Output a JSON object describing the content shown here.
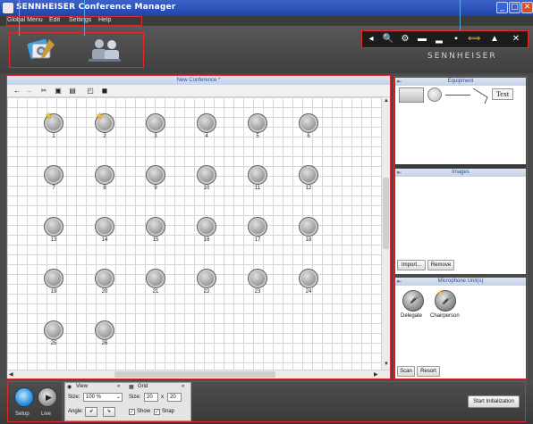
{
  "window": {
    "title": "SENNHEISER Conference Manager",
    "controls": {
      "minimize": "_",
      "maximize": "□",
      "close": "✕"
    }
  },
  "menu": [
    "Global Menu",
    "Edit",
    "Settings",
    "Help"
  ],
  "header": {
    "left_icons": [
      "conference-setup-icon",
      "users-icon"
    ],
    "toolbar_icons": [
      "volume-icon",
      "zoom-icon",
      "settings-icon",
      "card-icon",
      "signal-icon",
      "lock-icon",
      "swap-icon",
      "warning-icon",
      "close-icon"
    ],
    "brand": "SENNHEISER"
  },
  "canvas": {
    "title": "New Conference *",
    "toolbar_icons": [
      "undo-icon",
      "redo-icon",
      "cut-icon",
      "copy-icon",
      "paste-icon",
      "front-icon",
      "back-icon"
    ],
    "microphones": [
      {
        "label": "1",
        "chair": true
      },
      {
        "label": "2",
        "chair": true
      },
      {
        "label": "3"
      },
      {
        "label": "4"
      },
      {
        "label": "5"
      },
      {
        "label": "6"
      },
      {
        "label": "7"
      },
      {
        "label": "8"
      },
      {
        "label": "9"
      },
      {
        "label": "10"
      },
      {
        "label": "11"
      },
      {
        "label": "12"
      },
      {
        "label": "13"
      },
      {
        "label": "14"
      },
      {
        "label": "15"
      },
      {
        "label": "16"
      },
      {
        "label": "17"
      },
      {
        "label": "18"
      },
      {
        "label": "19"
      },
      {
        "label": "20"
      },
      {
        "label": "21"
      },
      {
        "label": "22"
      },
      {
        "label": "23"
      },
      {
        "label": "24"
      },
      {
        "label": "25"
      },
      {
        "label": "26"
      }
    ]
  },
  "equipment": {
    "title": "Equipment",
    "shapes": [
      "rectangle",
      "circle",
      "line",
      "polyline",
      "text"
    ],
    "text_tool": "Text"
  },
  "images": {
    "title": "Images",
    "import_label": "Import...",
    "remove_label": "Remove"
  },
  "mic_units": {
    "title": "Microphone Unit(s)",
    "delegate_label": "Delegate",
    "chairperson_label": "Chairperson",
    "scan_label": "Scan",
    "resort_label": "Resort"
  },
  "bottom": {
    "setup_label": "Setup",
    "live_label": "Live",
    "view": {
      "title": "View",
      "size_label": "Size:",
      "size_value": "100 %",
      "angle_label": "Angle:"
    },
    "grid": {
      "title": "Grid",
      "size_label": "Size:",
      "width": "20",
      "x": "x",
      "height": "20",
      "show_label": "Show",
      "snap_label": "Snap",
      "show_checked": true,
      "snap_checked": true
    },
    "start_label": "Start Initialization"
  },
  "colors": {
    "annotation": "#e2282a",
    "titlebar": "#1f44a8",
    "panel_header_text": "#2a4ea0"
  }
}
